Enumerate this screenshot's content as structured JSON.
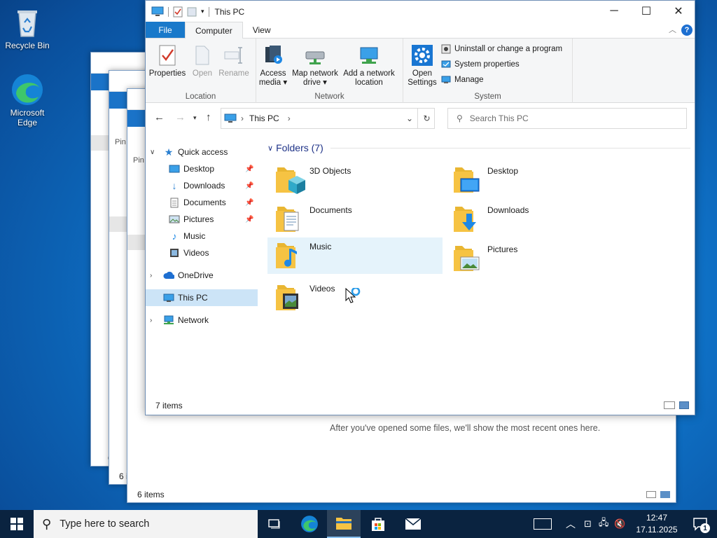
{
  "desktop": {
    "icons": [
      {
        "label": "Recycle Bin"
      },
      {
        "label": "Microsoft Edge"
      }
    ]
  },
  "background_windows": {
    "recent_message": "After you've opened some files, we'll show the most recent ones here.",
    "status_a": "6 items",
    "status_b": "6 i",
    "status_c": "6 i",
    "pin_a": "Pin",
    "pin_b": "Pin"
  },
  "window": {
    "title": "This PC",
    "tabs": [
      "File",
      "Computer",
      "View"
    ],
    "ribbon": {
      "location": {
        "label": "Location",
        "buttons": [
          "Properties",
          "Open",
          "Rename"
        ]
      },
      "network": {
        "label": "Network",
        "buttons": [
          {
            "line1": "Access",
            "line2": "media ▾"
          },
          {
            "line1": "Map network",
            "line2": "drive ▾"
          },
          {
            "line1": "Add a network",
            "line2": "location"
          }
        ]
      },
      "system": {
        "label": "System",
        "open_settings": {
          "line1": "Open",
          "line2": "Settings"
        },
        "items": [
          "Uninstall or change a program",
          "System properties",
          "Manage"
        ]
      }
    },
    "address": {
      "path": "This PC",
      "search_placeholder": "Search This PC"
    },
    "nav": {
      "quick_access": "Quick access",
      "quick_items": [
        "Desktop",
        "Downloads",
        "Documents",
        "Pictures",
        "Music",
        "Videos"
      ],
      "onedrive": "OneDrive",
      "this_pc": "This PC",
      "network": "Network"
    },
    "folders_header": "Folders (7)",
    "folders": [
      "3D Objects",
      "Desktop",
      "Documents",
      "Downloads",
      "Music",
      "Pictures",
      "Videos"
    ],
    "status": "7 items"
  },
  "taskbar": {
    "search_placeholder": "Type here to search",
    "time": "12:47",
    "date": "17.11.2025",
    "notification_count": "1"
  },
  "colors": {
    "accent": "#1979ca",
    "selection": "#cce4f7",
    "folder_yellow": "#f6c343",
    "taskbar": "#0a2340"
  }
}
